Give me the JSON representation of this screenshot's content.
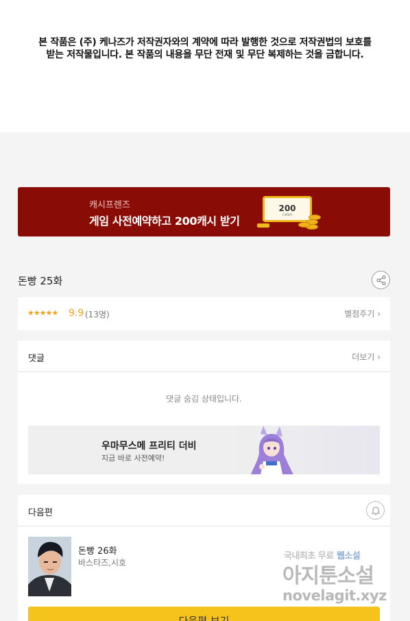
{
  "notice": {
    "line1": "본 작품은 (주) 케나즈가 저작권자와의 계약에 따라 발행한 것으로 저작권법의 보호를",
    "line2": "받는 저작물입니다. 본 작품의 내용을 무단 전재 및 무단 복제하는 것을 금합니다."
  },
  "banner": {
    "subtitle": "캐시프렌즈",
    "title": "게임 사전예약하고 200캐시 받기",
    "card_amount": "200",
    "card_tag": "CASH"
  },
  "episode": {
    "title": "돈빵 25화",
    "share_icon": "share-icon"
  },
  "rating": {
    "stars": "★★★★★",
    "score": "9.9",
    "votes": "(13명)",
    "rate_link": "별점주기 ›"
  },
  "comments": {
    "title": "댓글",
    "more": "더보기 ›",
    "hidden_message": "댓글 숨김 상태입니다.",
    "ad": {
      "title": "우마무스메 프리티 더비",
      "subtitle": "지금 바로 사전예약!"
    }
  },
  "next_episode": {
    "header": "다음편",
    "title": "돈빵 26화",
    "author": "바스타즈,시호",
    "button": "다음편 보기"
  },
  "watermark": {
    "top_a": "국내최초 무료",
    "top_b": "웹소설",
    "middle": "아지툰소설",
    "bottom": "novelagit.xyz"
  },
  "colors": {
    "banner_bg": "#8a0c06",
    "accent_star": "#f0a31c",
    "button_yellow": "#f6c21c"
  }
}
